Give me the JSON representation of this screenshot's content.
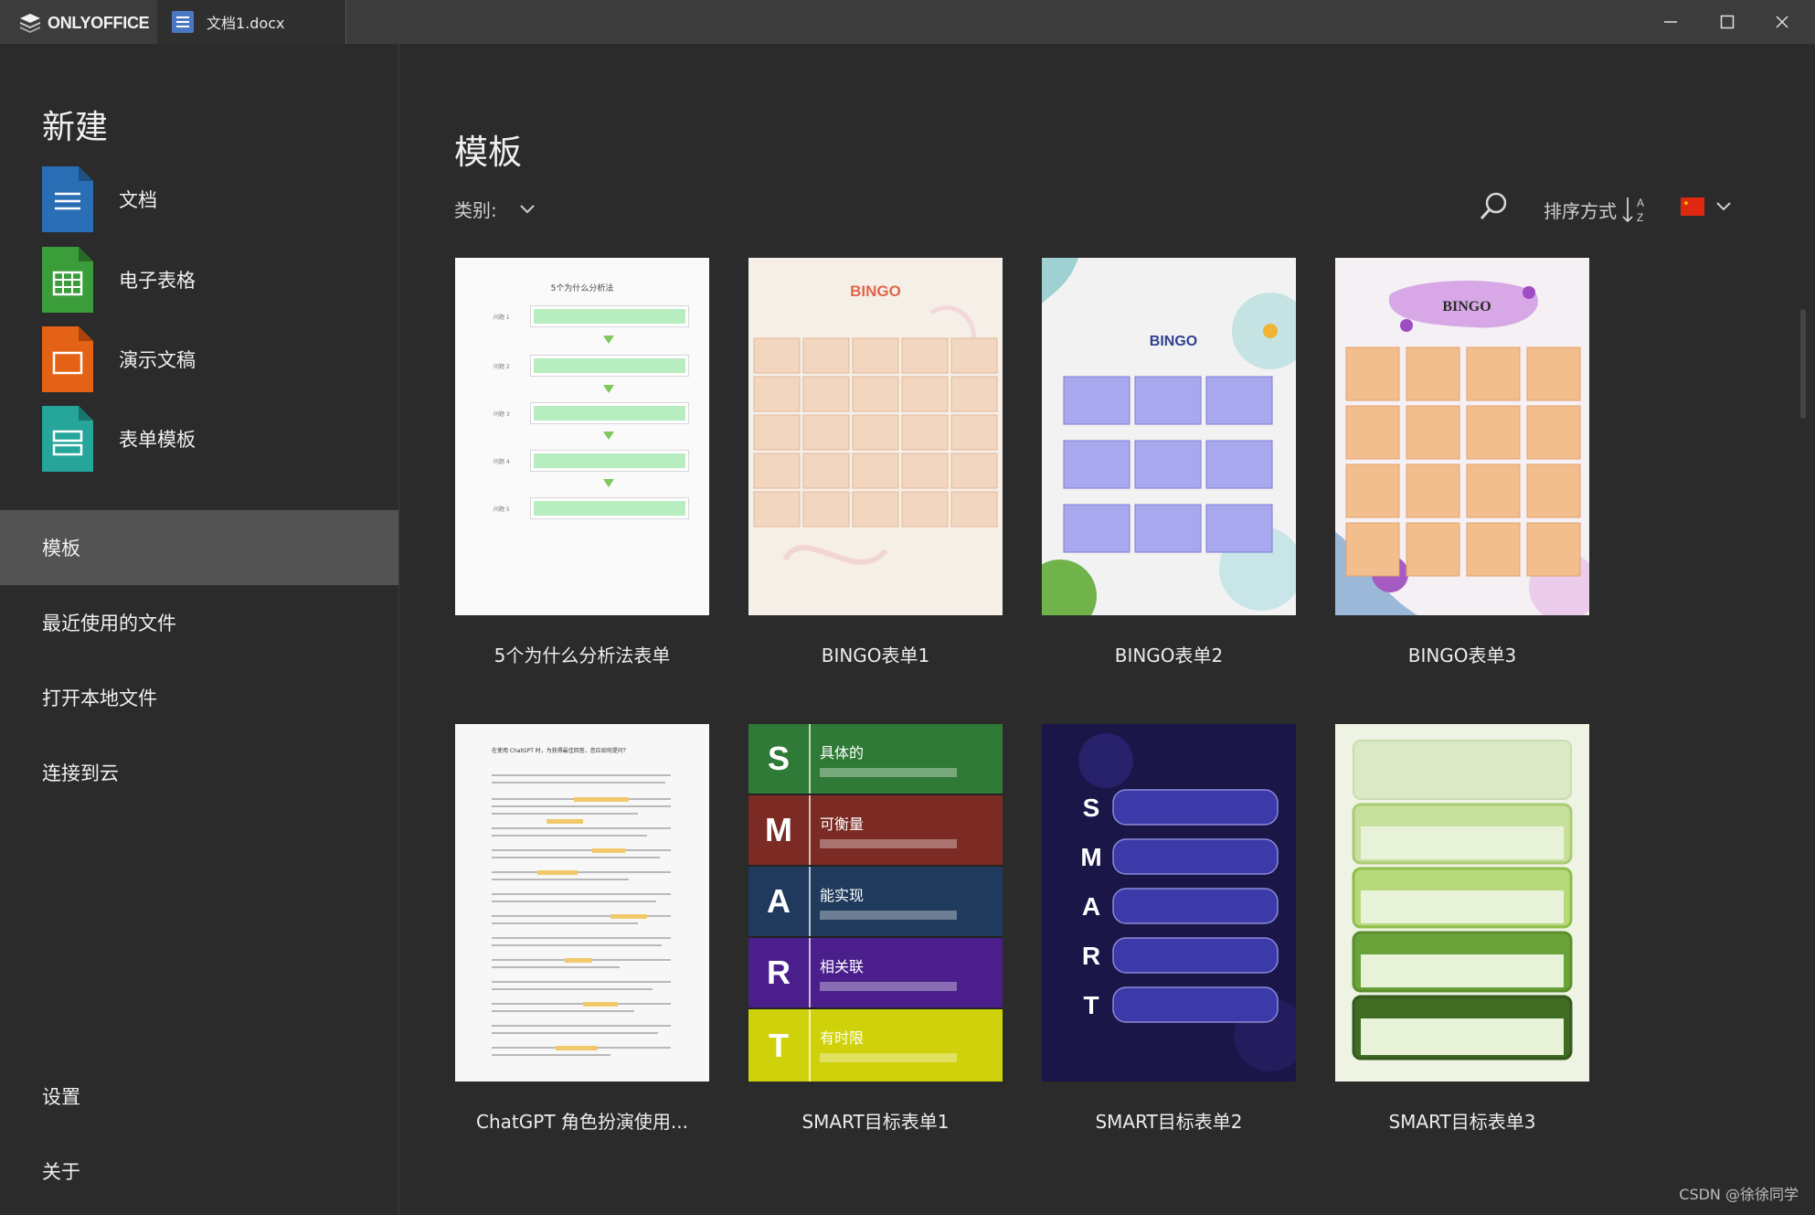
{
  "titlebar": {
    "brand": "ONLYOFFICE",
    "tab_label": "文档1.docx"
  },
  "sidebar": {
    "new_title": "新建",
    "new_items": [
      {
        "label": "文档",
        "icon": "document-icon",
        "color": "#2a6fb6"
      },
      {
        "label": "电子表格",
        "icon": "spreadsheet-icon",
        "color": "#3b9c3a"
      },
      {
        "label": "演示文稿",
        "icon": "presentation-icon",
        "color": "#e46215"
      },
      {
        "label": "表单模板",
        "icon": "form-template-icon",
        "color": "#26a69a"
      }
    ],
    "nav_items": [
      {
        "label": "模板",
        "active": true
      },
      {
        "label": "最近使用的文件",
        "active": false
      },
      {
        "label": "打开本地文件",
        "active": false
      },
      {
        "label": "连接到云",
        "active": false
      }
    ],
    "footer_items": [
      {
        "label": "设置"
      },
      {
        "label": "关于"
      }
    ]
  },
  "main": {
    "title": "模板",
    "category_label": "类别:",
    "sort_label": "排序方式",
    "language": "flag-cn-icon",
    "templates": [
      {
        "name": "5个为什么分析法表单",
        "thumb": "5-whys"
      },
      {
        "name": "BINGO表单1",
        "thumb": "bingo-1"
      },
      {
        "name": "BINGO表单2",
        "thumb": "bingo-2"
      },
      {
        "name": "BINGO表单3",
        "thumb": "bingo-3"
      },
      {
        "name": "ChatGPT 角色扮演使用...",
        "thumb": "chatgpt"
      },
      {
        "name": "SMART目标表单1",
        "thumb": "smart-1"
      },
      {
        "name": "SMART目标表单2",
        "thumb": "smart-2"
      },
      {
        "name": "SMART目标表单3",
        "thumb": "smart-3"
      }
    ],
    "thumb_text": {
      "five_whys_title": "5个为什么分析法",
      "bingo": "BINGO",
      "smart_letters": [
        "S",
        "M",
        "A",
        "R",
        "T"
      ],
      "smart_titles": [
        "具体的",
        "可衡量",
        "能实现",
        "相关联",
        "有时限"
      ],
      "chatgpt_heading": "在使用 ChatGPT 时，为获得最佳回答，您应如何提问？"
    }
  },
  "watermark": "CSDN @徐徐同学"
}
